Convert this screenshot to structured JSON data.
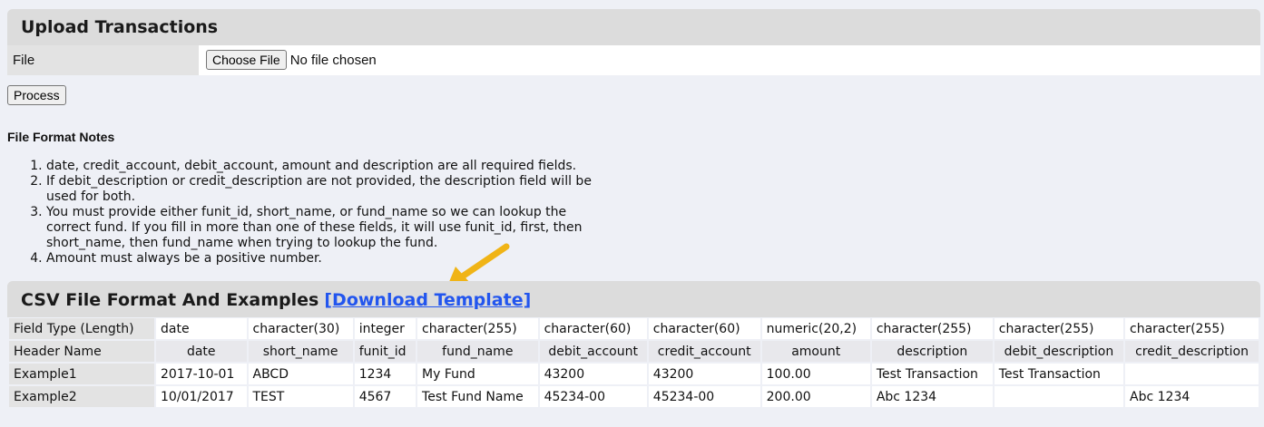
{
  "upload": {
    "title": "Upload Transactions",
    "file_label": "File",
    "choose_file_label": "Choose File",
    "no_file_text": "No file chosen",
    "process_label": "Process"
  },
  "notes": {
    "title": "File Format Notes",
    "items": [
      "date, credit_account, debit_account, amount and description are all required fields.",
      "If debit_description or credit_description are not provided, the description field will be used for both.",
      "You must provide either funit_id, short_name, or fund_name so we can lookup the correct fund. If you fill in more than one of these fields, it will use funit_id, first, then short_name, then fund_name when trying to lookup the fund.",
      "Amount must always be a positive number."
    ]
  },
  "csv": {
    "title": "CSV File Format And Examples",
    "download_link": "[Download Template]",
    "rows": [
      {
        "label": "Field Type (Length)",
        "cells": [
          "date",
          "character(30)",
          "integer",
          "character(255)",
          "character(60)",
          "character(60)",
          "numeric(20,2)",
          "character(255)",
          "character(255)",
          "character(255)"
        ]
      },
      {
        "label": "Header Name",
        "cells": [
          "date",
          "short_name",
          "funit_id",
          "fund_name",
          "debit_account",
          "credit_account",
          "amount",
          "description",
          "debit_description",
          "credit_description"
        ]
      },
      {
        "label": "Example1",
        "cells": [
          "2017-10-01",
          "ABCD",
          "1234",
          "My Fund",
          "43200",
          "43200",
          "100.00",
          "Test Transaction",
          "Test Transaction",
          ""
        ]
      },
      {
        "label": "Example2",
        "cells": [
          "10/01/2017",
          "TEST",
          "4567",
          "Test Fund Name",
          "45234-00",
          "45234-00",
          "200.00",
          "Abc 1234",
          "",
          "Abc 1234"
        ]
      }
    ]
  },
  "colors": {
    "link": "#2255ee",
    "arrow": "#f0b416"
  }
}
